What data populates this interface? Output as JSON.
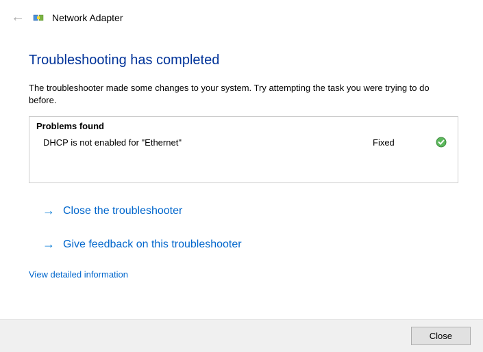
{
  "header": {
    "title": "Network Adapter"
  },
  "main": {
    "heading": "Troubleshooting has completed",
    "description": "The troubleshooter made some changes to your system. Try attempting the task you were trying to do before."
  },
  "problems": {
    "title": "Problems found",
    "items": [
      {
        "text": "DHCP is not enabled for \"Ethernet\"",
        "status": "Fixed"
      }
    ]
  },
  "actions": {
    "close_troubleshooter": "Close the troubleshooter",
    "give_feedback": "Give feedback on this troubleshooter",
    "view_detailed": "View detailed information"
  },
  "footer": {
    "close_label": "Close"
  }
}
